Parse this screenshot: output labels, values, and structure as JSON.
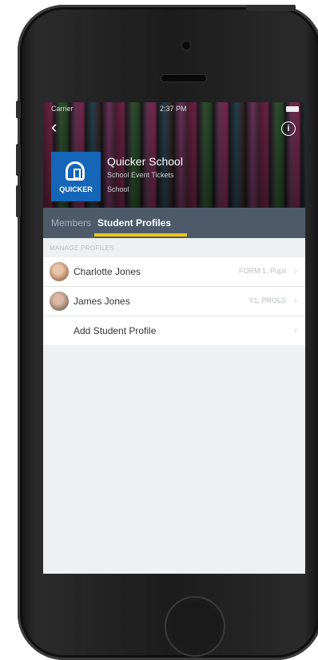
{
  "status": {
    "carrier": "Carrier",
    "time": "2:37 PM"
  },
  "header": {
    "school_name": "Quicker School",
    "subtitle": "School Event Tickets",
    "subtitle2": "School",
    "logo_text": "QUICKER"
  },
  "tabs": [
    {
      "label": "Members"
    },
    {
      "label": "Student Profiles",
      "active": true
    }
  ],
  "section_header": "MANAGE PROFILES",
  "profiles": [
    {
      "name": "Charlotte Jones",
      "detail": "FORM 1, Pupil"
    },
    {
      "name": "James Jones",
      "detail": "Y1, PROLS"
    }
  ],
  "add_profile_label": "Add Student Profile",
  "colors": {
    "tab_bar": "#4d5a6a",
    "indicator": "#f2c518",
    "logo_bg": "#1565b8"
  }
}
